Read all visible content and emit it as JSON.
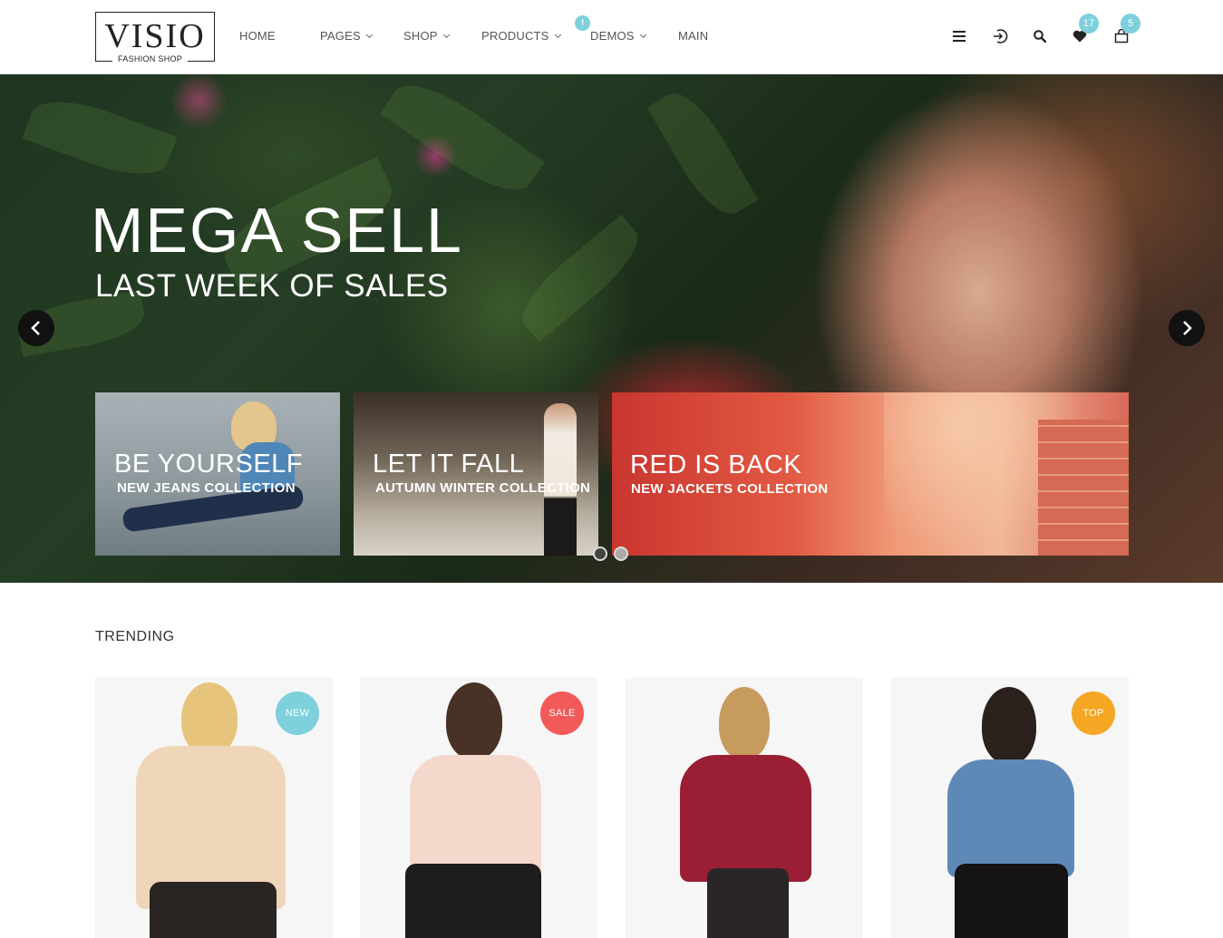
{
  "logo": {
    "name": "VISIO",
    "tagline": "FASHION SHOP"
  },
  "nav": {
    "items": [
      {
        "label": "HOME",
        "dropdown": false
      },
      {
        "label": "PAGES",
        "dropdown": true
      },
      {
        "label": "SHOP",
        "dropdown": true
      },
      {
        "label": "PRODUCTS",
        "dropdown": true
      },
      {
        "label": "DEMOS",
        "dropdown": true
      },
      {
        "label": "MAIN",
        "dropdown": false
      }
    ],
    "badge": "!"
  },
  "header_icons": [
    {
      "name": "menu-icon"
    },
    {
      "name": "login-icon"
    },
    {
      "name": "search-icon"
    },
    {
      "name": "heart-icon",
      "count": "17"
    },
    {
      "name": "cart-icon",
      "count": "5"
    }
  ],
  "hero": {
    "title": "MEGA SELL",
    "subtitle": "LAST WEEK OF SALES",
    "cards": [
      {
        "title": "BE YOURSELF",
        "subtitle": "NEW JEANS COLLECTION"
      },
      {
        "title": "LET IT FALL",
        "subtitle": "AUTUMN WINTER COLLECTION"
      },
      {
        "title": "RED IS BACK",
        "subtitle": "NEW JACKETS COLLECTION"
      }
    ],
    "slides_total": 2,
    "active_slide": 1
  },
  "trending": {
    "title": "TRENDING",
    "products": [
      {
        "badge": "NEW",
        "badge_color": "#7dd0dc"
      },
      {
        "badge": "SALE",
        "badge_color": "#f25a5a"
      },
      {
        "badge": "",
        "badge_color": ""
      },
      {
        "badge": "TOP",
        "badge_color": "#f5a623"
      }
    ]
  },
  "colors": {
    "accent": "#7dd0dc",
    "sale": "#f25a5a",
    "top": "#f5a623"
  }
}
